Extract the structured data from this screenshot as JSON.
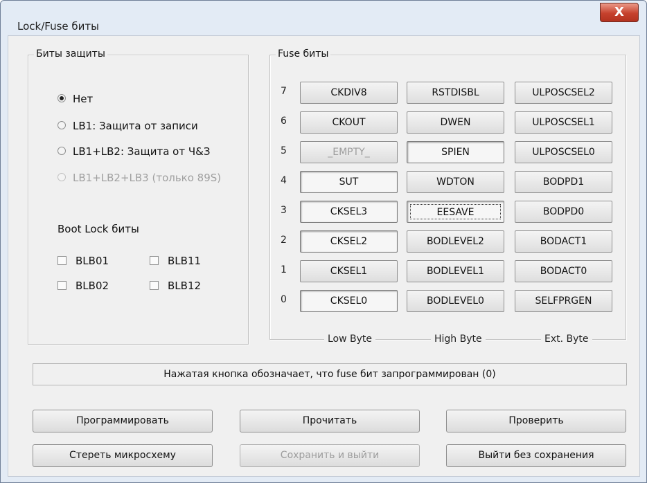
{
  "window": {
    "title": "Lock/Fuse биты",
    "close_glyph": "X"
  },
  "lock_group": {
    "title": "Биты защиты",
    "options": [
      {
        "label": "Нет",
        "selected": true,
        "enabled": true
      },
      {
        "label": "LB1: Защита от записи",
        "selected": false,
        "enabled": true
      },
      {
        "label": "LB1+LB2: Защита от Ч&З",
        "selected": false,
        "enabled": true
      },
      {
        "label": "LB1+LB2+LB3 (только 89S)",
        "selected": false,
        "enabled": false
      }
    ],
    "boot_lock_title": "Boot Lock биты",
    "boot_lock_bits": [
      "BLB01",
      "BLB11",
      "BLB02",
      "BLB12"
    ]
  },
  "fuse_group": {
    "title": "Fuse биты",
    "bit_numbers": [
      "7",
      "6",
      "5",
      "4",
      "3",
      "2",
      "1",
      "0"
    ],
    "columns": [
      "Low Byte",
      "High Byte",
      "Ext. Byte"
    ],
    "low_byte": [
      {
        "label": "CKDIV8",
        "state": "normal"
      },
      {
        "label": "CKOUT",
        "state": "normal"
      },
      {
        "label": "_EMPTY_",
        "state": "disabled"
      },
      {
        "label": "SUT",
        "state": "pressed"
      },
      {
        "label": "CKSEL3",
        "state": "pressed"
      },
      {
        "label": "CKSEL2",
        "state": "pressed"
      },
      {
        "label": "CKSEL1",
        "state": "normal"
      },
      {
        "label": "CKSEL0",
        "state": "pressed"
      }
    ],
    "high_byte": [
      {
        "label": "RSTDISBL",
        "state": "normal"
      },
      {
        "label": "DWEN",
        "state": "normal"
      },
      {
        "label": "SPIEN",
        "state": "pressed"
      },
      {
        "label": "WDTON",
        "state": "normal"
      },
      {
        "label": "EESAVE",
        "state": "focused"
      },
      {
        "label": "BODLEVEL2",
        "state": "normal"
      },
      {
        "label": "BODLEVEL1",
        "state": "normal"
      },
      {
        "label": "BODLEVEL0",
        "state": "normal"
      }
    ],
    "ext_byte": [
      {
        "label": "ULPOSCSEL2",
        "state": "normal"
      },
      {
        "label": "ULPOSCSEL1",
        "state": "normal"
      },
      {
        "label": "ULPOSCSEL0",
        "state": "normal"
      },
      {
        "label": "BODPD1",
        "state": "normal"
      },
      {
        "label": "BODPD0",
        "state": "normal"
      },
      {
        "label": "BODACT1",
        "state": "normal"
      },
      {
        "label": "BODACT0",
        "state": "normal"
      },
      {
        "label": "SELFPRGEN",
        "state": "normal"
      }
    ]
  },
  "status": "Нажатая кнопка обозначает, что fuse бит запрограммирован (0)",
  "buttons": {
    "program": "Программировать",
    "read": "Прочитать",
    "verify": "Проверить",
    "erase": "Стереть микросхему",
    "save_exit": "Сохранить и выйти",
    "exit_no_save": "Выйти без сохранения"
  }
}
